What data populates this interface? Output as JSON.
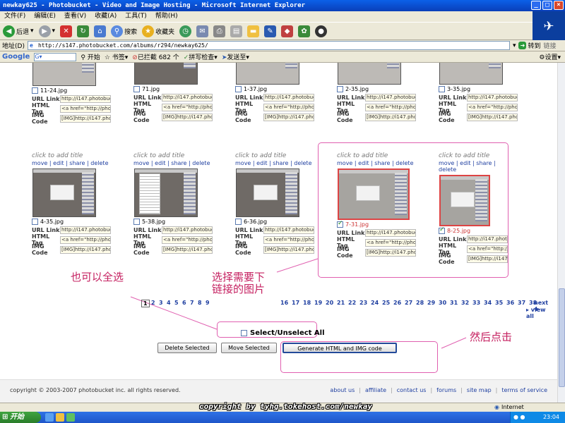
{
  "window": {
    "title": "newkay625 - Photobucket - Video and Image Hosting - Microsoft Internet Explorer"
  },
  "menu": [
    "文件(F)",
    "编辑(E)",
    "查看(V)",
    "收藏(A)",
    "工具(T)",
    "帮助(H)"
  ],
  "toolbar": {
    "back": "后退",
    "search": "搜索",
    "favorites": "收藏夹"
  },
  "address": {
    "label": "地址(D)",
    "url": "http://s147.photobucket.com/albums/r294/newkay625/",
    "go": "转到",
    "links": "链接"
  },
  "googlebar": {
    "logo": "Google",
    "start": "开始",
    "bookmarks": "书签▾",
    "blocked": "已拦截 682 个",
    "spell": "拼写检查▾",
    "send": "发送至▾",
    "settings": "设置▾"
  },
  "tiles_top": [
    {
      "name": "11-24.jpg"
    },
    {
      "name": "71.jpg"
    },
    {
      "name": "1-37.jpg"
    },
    {
      "name": "2-35.jpg"
    },
    {
      "name": "3-35.jpg"
    }
  ],
  "tiles_bottom": [
    {
      "title": "click to add title",
      "name": "4-35.jpg",
      "checked": false
    },
    {
      "title": "click to add title",
      "name": "5-38.jpg",
      "checked": false
    },
    {
      "title": "click to add title",
      "name": "6-36.jpg",
      "checked": false
    },
    {
      "title": "click to add title",
      "name": "7-31.jpg",
      "checked": true
    },
    {
      "title": "click to add title",
      "name": "8-25.jpg",
      "checked": true
    }
  ],
  "actions": {
    "move": "move",
    "edit": "edit",
    "share": "share",
    "delete": "delete",
    "sep": "|"
  },
  "fields": {
    "url_label": "URL Link",
    "html_label": "HTML Tag",
    "img_label": "IMG Code",
    "url_val": "http://i147.photobuck",
    "html_val": "<a href=\"http://photol",
    "img_val": "[IMG]http://i147.phot"
  },
  "annotations": {
    "select_all_hint": "也可以全选",
    "select_needed_1": "选择需要下",
    "select_needed_2": "链接的图片",
    "then_click": "然后点击"
  },
  "pager": {
    "pages_left": [
      "1",
      "2",
      "3",
      "4",
      "5",
      "6",
      "7",
      "8",
      "9"
    ],
    "pages_right": [
      "16",
      "17",
      "18",
      "19",
      "20",
      "21",
      "22",
      "23",
      "24",
      "25",
      "26",
      "27",
      "28",
      "29",
      "30",
      "31",
      "32",
      "33",
      "34",
      "35",
      "36",
      "37",
      "38"
    ],
    "next": "next ✚",
    "view_all": "▸ view all"
  },
  "controls": {
    "select_all": "Select/Unselect All",
    "delete_selected": "Delete Selected",
    "move_selected": "Move Selected",
    "generate": "Generate HTML and IMG code"
  },
  "footer": {
    "copyright": "copyright © 2003-2007 photobucket inc. all rights reserved.",
    "links": [
      "about us",
      "affiliate",
      "contact us",
      "forums",
      "site map",
      "terms of service"
    ]
  },
  "status": {
    "watermark": "copyright by tyhg.tokehost.com/newkay",
    "zone": "Internet"
  },
  "taskbar": {
    "start": "开始",
    "time": "23:04"
  }
}
